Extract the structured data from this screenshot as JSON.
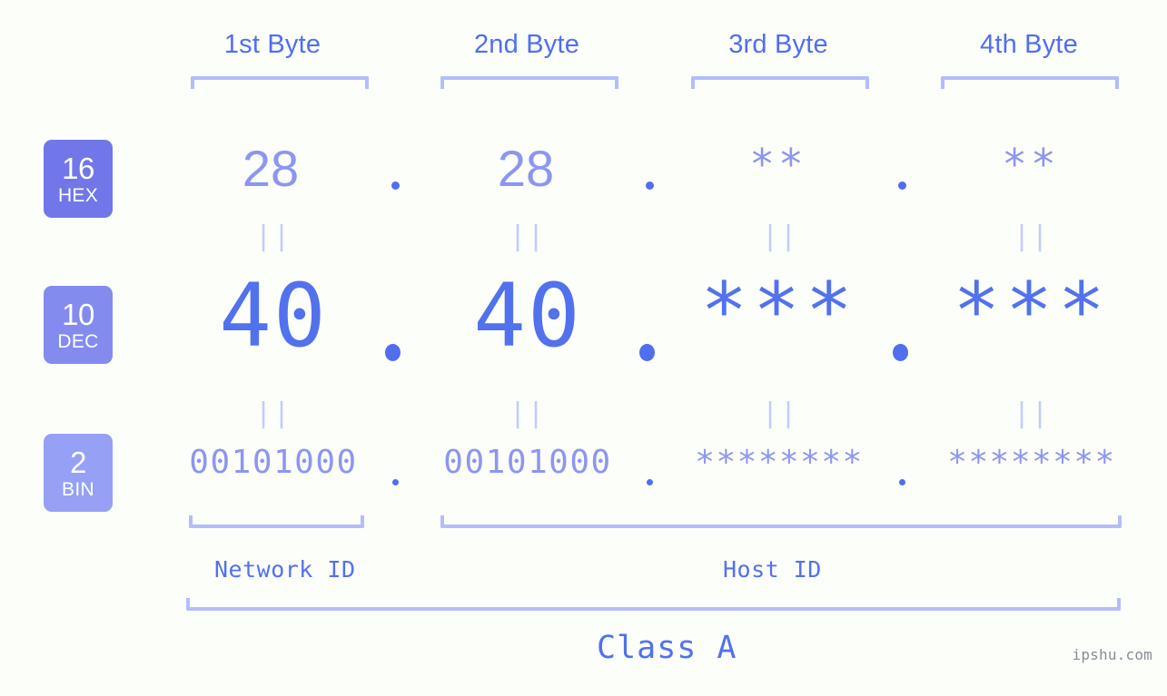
{
  "watermark": "ipshu.com",
  "colors": {
    "background": "#fcfefa",
    "accent_strong": "#4f6ef0",
    "accent_mid": "#5271ed",
    "accent_light": "#8c96f0",
    "bracket": "#b4bdfb",
    "equals": "#c3cbfd",
    "badge_hex": "#7177e8",
    "badge_dec": "#848bee",
    "badge_bin": "#96a0f5",
    "watermark": "#8a8a95"
  },
  "byte_headers": [
    {
      "label": "1st Byte"
    },
    {
      "label": "2nd Byte"
    },
    {
      "label": "3rd Byte"
    },
    {
      "label": "4th Byte"
    }
  ],
  "radix_badges": [
    {
      "number": "16",
      "abbr": "HEX",
      "color": "#7177e8"
    },
    {
      "number": "10",
      "abbr": "DEC",
      "color": "#848bee"
    },
    {
      "number": "2",
      "abbr": "BIN",
      "color": "#96a0f5"
    }
  ],
  "rows": {
    "hex": {
      "values": [
        "28",
        "28",
        "**",
        "**"
      ],
      "separator": "."
    },
    "dec": {
      "values": [
        "40",
        "40",
        "***",
        "***"
      ],
      "separator": "."
    },
    "bin": {
      "values": [
        "00101000",
        "00101000",
        "********",
        "********"
      ],
      "separator": "."
    }
  },
  "equals_mark": "||",
  "segments": {
    "network_id": "Network ID",
    "host_id": "Host ID",
    "class": "Class A"
  }
}
